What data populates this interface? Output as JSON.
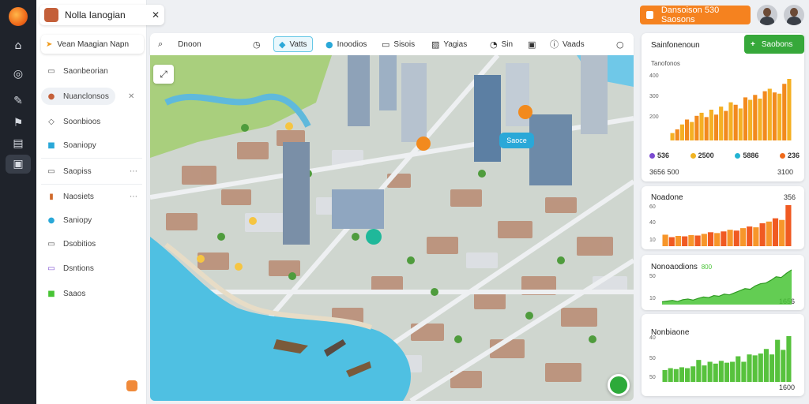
{
  "app": {
    "tab_title": "Nolla Ianogian",
    "search_label": "Vean Maagian Napn"
  },
  "rail": {
    "icons": [
      "home-icon",
      "circle-icon",
      "pen-icon",
      "flag-icon",
      "grid-icon",
      "chat-icon"
    ]
  },
  "sidebar": {
    "items": [
      {
        "label": "Saonbeorian",
        "icon": "chat-icon"
      },
      {
        "label": "Nuanclonsos",
        "icon": "avatar-icon",
        "selected": true
      },
      {
        "label": "Soonbioos",
        "icon": "layers-icon"
      },
      {
        "label": "Soaniopy",
        "icon": "tag-icon"
      },
      {
        "label": "Saopiss",
        "icon": "folder-icon"
      },
      {
        "label": "Naosiets",
        "icon": "building-icon"
      },
      {
        "label": "Saniopy",
        "icon": "pin-icon"
      },
      {
        "label": "Dsobitios",
        "icon": "settings-icon"
      },
      {
        "label": "Dsntions",
        "icon": "users-icon"
      },
      {
        "label": "Saaos",
        "icon": "leaf-icon"
      }
    ]
  },
  "toolbar": {
    "items": [
      {
        "label": "Dnoon",
        "icon": "search-icon"
      },
      {
        "label": "",
        "icon": "clock-icon"
      },
      {
        "label": "Vatts",
        "icon": "layers-icon",
        "active": true
      },
      {
        "label": "Inoodios",
        "icon": "globe-icon"
      },
      {
        "label": "Sisois",
        "icon": "bus-icon"
      },
      {
        "label": "Yagias",
        "icon": "image-icon"
      },
      {
        "label": "Sin",
        "icon": "compass-icon"
      },
      {
        "label": "",
        "icon": "bookmark-icon"
      },
      {
        "label": "Vaads",
        "icon": "info-icon"
      },
      {
        "label": "",
        "icon": "search-icon"
      }
    ]
  },
  "map": {
    "tag_label": "Saoce"
  },
  "header": {
    "cta_label": "Dansoison 530 Saosons",
    "avatars": [
      "user-avatar-1",
      "user-avatar-2"
    ]
  },
  "panels": {
    "summary": {
      "title": "Sainfonenoun",
      "add_label": "Saobons",
      "subtitle": "Tanofonos",
      "y_ticks": [
        "400",
        "300",
        "200"
      ],
      "legend": [
        {
          "label": "536",
          "color": "#7b4bd1"
        },
        {
          "label": "2500",
          "color": "#f0b323"
        },
        {
          "label": "5886",
          "color": "#22b3d2"
        },
        {
          "label": "236",
          "color": "#f06a1a"
        }
      ],
      "foot_left": "3656 500",
      "foot_right": "3100"
    },
    "orange": {
      "title": "Noadone",
      "y_ticks": [
        "60",
        "40",
        "10"
      ],
      "value": "356"
    },
    "green1": {
      "title": "Nonoaodions",
      "badge": "800",
      "y_ticks": [
        "50",
        "10"
      ],
      "value": "1656"
    },
    "green2": {
      "title": "Nonbiaone",
      "y_ticks": [
        "40",
        "50",
        "50"
      ],
      "value": "1600"
    }
  },
  "chart_data": [
    {
      "type": "bar",
      "title": "Sainfonenoun",
      "y_ticks": [
        "400",
        "300",
        "200"
      ],
      "colors": [
        "#f5b024",
        "#f28a1e"
      ],
      "values": [
        12,
        18,
        26,
        34,
        30,
        40,
        45,
        38,
        50,
        42,
        55,
        48,
        62,
        58,
        52,
        70,
        66,
        74,
        68,
        80,
        84,
        78,
        76,
        92,
        100
      ]
    },
    {
      "type": "bar",
      "title": "Noadone",
      "y_ticks": [
        "60",
        "40",
        "10"
      ],
      "colors": [
        "#f7962a",
        "#f05a22"
      ],
      "values": [
        28,
        22,
        25,
        24,
        27,
        26,
        30,
        34,
        32,
        36,
        40,
        38,
        44,
        48,
        46,
        56,
        60,
        68,
        64,
        100
      ]
    },
    {
      "type": "area",
      "title": "Nonoaodions",
      "y_ticks": [
        "50",
        "10"
      ],
      "colors": [
        "#48c435"
      ],
      "values": [
        8,
        10,
        12,
        9,
        14,
        16,
        13,
        18,
        22,
        20,
        26,
        24,
        30,
        28,
        34,
        40,
        46,
        44,
        54,
        60,
        62,
        70,
        80,
        78,
        90,
        100
      ]
    },
    {
      "type": "bar",
      "title": "Nonbiaone",
      "y_ticks": [
        "40",
        "50",
        "50"
      ],
      "colors": [
        "#57c23d"
      ],
      "values": [
        26,
        30,
        28,
        32,
        30,
        34,
        48,
        36,
        44,
        40,
        46,
        42,
        44,
        56,
        44,
        60,
        58,
        62,
        72,
        60,
        92,
        70,
        100
      ]
    }
  ]
}
